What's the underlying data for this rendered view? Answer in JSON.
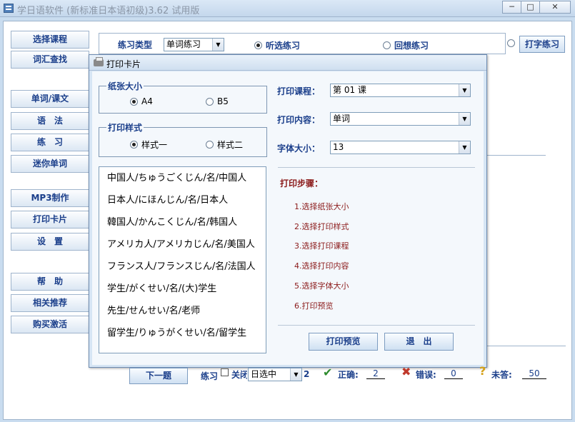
{
  "window": {
    "title": "学日语软件 (新标准日本语初级)3.62 试用版",
    "buttons": {
      "minimize": "─",
      "maximize": "□",
      "close": "✕"
    }
  },
  "sidebar": {
    "items": [
      "选择课程",
      "词汇查找",
      "单词/课文",
      "语　法",
      "练　习",
      "迷你单词",
      "MP3制作",
      "打印卡片",
      "设　置",
      "帮　助",
      "相关推荐",
      "购买激活"
    ]
  },
  "topbar": {
    "practice_type_label": "练习类型",
    "practice_type_value": "单词练习",
    "radio_listen": "听选练习",
    "radio_recall": "回想练习",
    "radio_typing": "打字练习"
  },
  "dialog": {
    "title": "打印卡片",
    "paper_size": {
      "legend": "纸张大小",
      "options": [
        "A4",
        "B5"
      ],
      "selected": "A4"
    },
    "print_style": {
      "legend": "打印样式",
      "options": [
        "样式一",
        "样式二"
      ],
      "selected": "样式一"
    },
    "course_label": "打印课程：",
    "course_value": "第 01 课",
    "content_label": "打印内容：",
    "content_value": "单词",
    "fontsize_label": "字体大小：",
    "fontsize_value": "13",
    "preview_lines": [
      "中国人/ちゅうごくじん/名/中国人",
      "日本人/にほんじん/名/日本人",
      "韓国人/かんこくじん/名/韩国人",
      "アメリカ人/アメリカじん/名/美国人",
      "フランス人/フランスじん/名/法国人",
      "学生/がくせい/名/(大)学生",
      "先生/せんせい/名/老师",
      "留学生/りゅうがくせい/名/留学生"
    ],
    "steps_title": "打印步骤：",
    "steps": [
      "1.选择纸张大小",
      "2.选择打印样式",
      "3.选择打印课程",
      "4.选择打印内容",
      "5.选择字体大小",
      "6.打印预览"
    ],
    "preview_button": "打印预览",
    "exit_button": "退　出"
  },
  "bottom": {
    "next_button": "下一题",
    "practice_label": "练习",
    "checkbox_label": "关闭",
    "select_value": "日选中",
    "count": "2",
    "correct_label": "正确:",
    "correct_value": "2",
    "wrong_label": "错误:",
    "wrong_value": "0",
    "unanswered_label": "未答:",
    "unanswered_value": "50"
  },
  "colors": {
    "accent": "#1b3f8b",
    "steps": "#8b1a1a",
    "correct": "#2e8b2e",
    "wrong": "#c0392b",
    "unanswered": "#d4a017"
  }
}
